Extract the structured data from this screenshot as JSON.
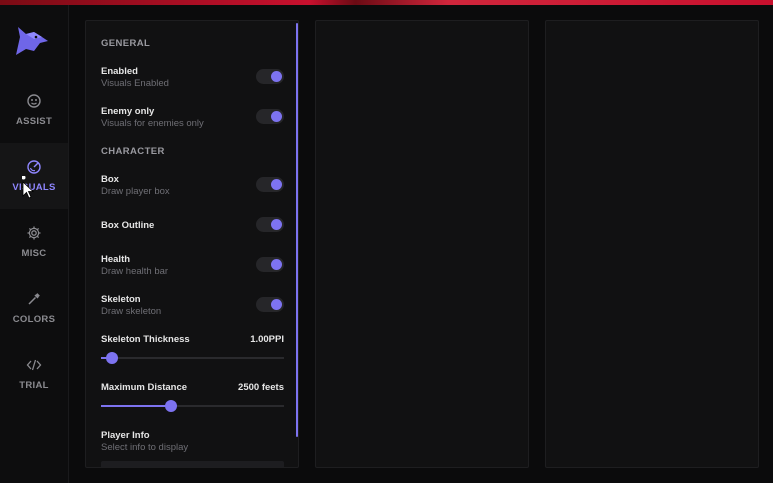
{
  "sidebar": {
    "items": [
      {
        "label": "ASSIST",
        "icon": "smiley-face-icon"
      },
      {
        "label": "VISUALS",
        "icon": "radar-icon",
        "active": true
      },
      {
        "label": "MISC",
        "icon": "gear-icon"
      },
      {
        "label": "COLORS",
        "icon": "eyedropper-icon"
      },
      {
        "label": "TRIAL",
        "icon": "code-brackets-icon"
      }
    ]
  },
  "panel": {
    "general_header": "GENERAL",
    "character_header": "CHARACTER",
    "options": [
      {
        "title": "Enabled",
        "desc": "Visuals Enabled",
        "enabled": true
      },
      {
        "title": "Enemy only",
        "desc": "Visuals for enemies only",
        "enabled": true
      },
      {
        "title": "Box",
        "desc": "Draw player box",
        "enabled": true
      },
      {
        "title": "Box Outline",
        "desc": "",
        "enabled": true
      },
      {
        "title": "Health",
        "desc": "Draw health bar",
        "enabled": true
      },
      {
        "title": "Skeleton",
        "desc": "Draw skeleton",
        "enabled": true
      }
    ],
    "sliders": [
      {
        "label": "Skeleton Thickness",
        "value_text": "1.00PPI",
        "fraction": 0.06
      },
      {
        "label": "Maximum Distance",
        "value_text": "2500 feets",
        "fraction": 0.38
      }
    ],
    "player_info": {
      "title": "Player Info",
      "desc": "Select info to display"
    }
  },
  "colors": {
    "accent": "#7d73f0",
    "top_bar": "#c8102e"
  }
}
